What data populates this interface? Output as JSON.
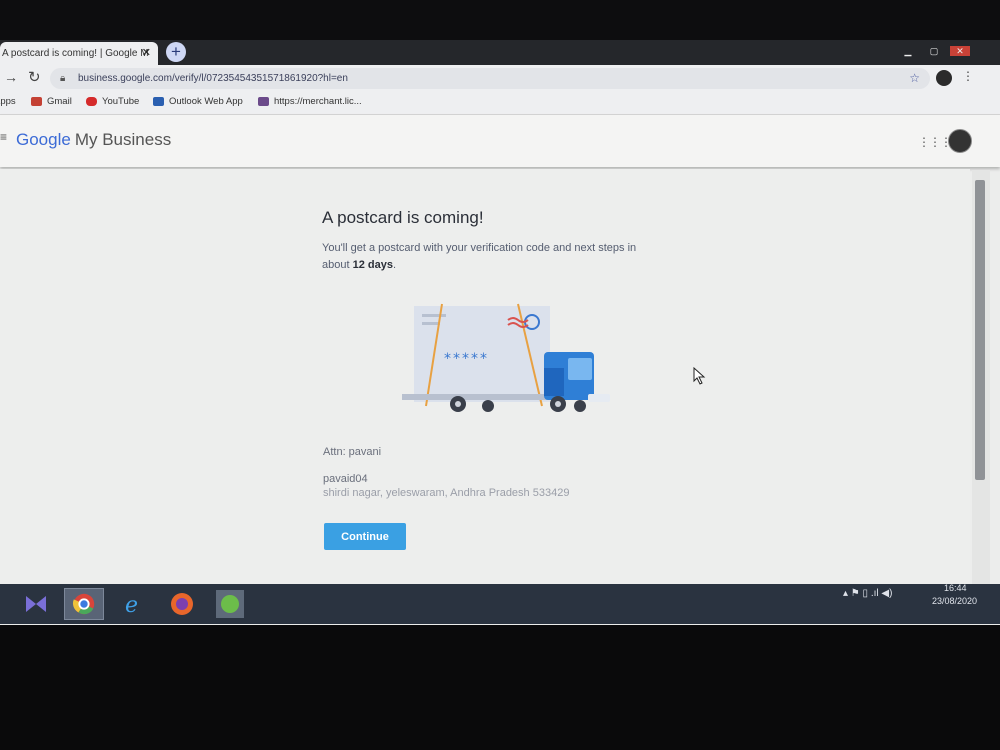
{
  "browser": {
    "tab_title": "A postcard is coming! | Google M",
    "tab_close": "✕",
    "new_tab": "+",
    "url": "business.google.com/verify/l/07235454351571861920?hl=en",
    "bookmarks": [
      {
        "label": "Apps",
        "icon_color": "#3a6fd8"
      },
      {
        "label": "Gmail",
        "icon_color": "#c44134"
      },
      {
        "label": "YouTube",
        "icon_color": "#d52b2b"
      },
      {
        "label": "Outlook Web App",
        "icon_color": "#2a5fb0"
      },
      {
        "label": "https://merchant.lic...",
        "icon_color": "#6b4a8a"
      }
    ]
  },
  "app": {
    "brand_google": "Google",
    "brand_rest": "My Business"
  },
  "page": {
    "title": "A postcard is coming!",
    "paragraph_prefix": "You'll get a postcard with your verification code and next steps in about",
    "paragraph_days": "12 days",
    "paragraph_suffix": ".",
    "postcard_code": "*****",
    "attn": "Attn: pavani",
    "business_name": "pavaid04",
    "address": "shirdi nagar, yeleswaram, Andhra Pradesh 533429",
    "continue_label": "Continue"
  },
  "taskbar": {
    "time": "16:44",
    "date": "23/08/2020",
    "tray_icons": "▴  ⚑  ▯  .ıl  ◀)"
  },
  "colors": {
    "accent": "#3aa0e3",
    "truck_blue": "#2f7fd6",
    "google_blue": "#3c6bd6"
  }
}
